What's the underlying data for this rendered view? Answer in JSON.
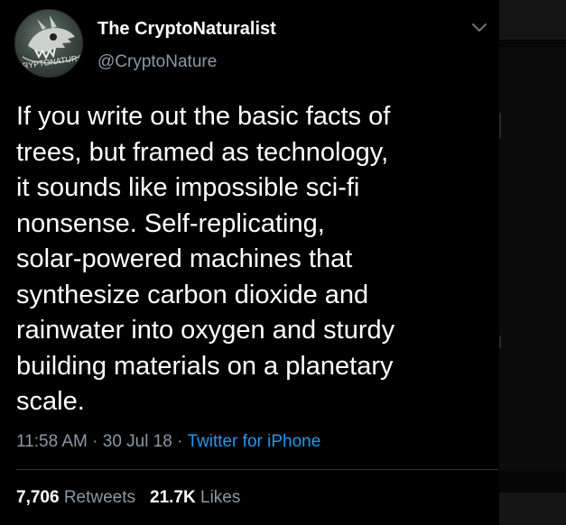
{
  "tweet": {
    "author_name": "The CryptoNaturalist",
    "author_handle": "@CryptoNature",
    "avatar_text": "CRYPTONATURALIST",
    "text_lines": [
      "If you write out the basic facts of",
      "trees, but framed as technology,",
      "it sounds like impossible sci-fi",
      "nonsense. Self-replicating,",
      "solar-powered machines that",
      "synthesize carbon dioxide and",
      "rainwater into oxygen and sturdy",
      "building materials on a planetary",
      "scale."
    ],
    "time": "11:58 AM",
    "separator": " · ",
    "date": "30 Jul 18",
    "source": "Twitter for iPhone",
    "retweets_count": "7,706",
    "retweets_label": "Retweets",
    "likes_count": "21.7K",
    "likes_label": "Likes"
  },
  "colors": {
    "background": "#000000",
    "primary_text": "#ffffff",
    "secondary_text": "#8b98a5",
    "link": "#1d9bf0",
    "divider": "#2f3336"
  },
  "icons": {
    "menu": "chevron-down-icon",
    "avatar": "dragon-skull-avatar"
  }
}
